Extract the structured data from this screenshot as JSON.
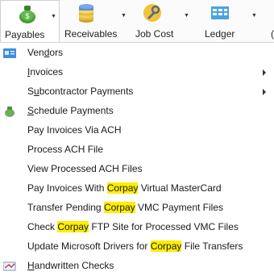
{
  "toolbar": {
    "items": [
      {
        "label": "Payables",
        "icon": "payables-icon",
        "active": true
      },
      {
        "label": "Receivables",
        "icon": "receivables-icon"
      },
      {
        "label": "Job Cost",
        "icon": "job-cost-icon"
      },
      {
        "label": "Ledger",
        "icon": "ledger-icon"
      }
    ]
  },
  "menu": {
    "items": [
      {
        "parts": [
          "Ven",
          "d",
          "ors"
        ],
        "icon": "vendors-icon"
      },
      {
        "parts": [
          "",
          "I",
          "nvoices"
        ],
        "submenu": true
      },
      {
        "parts": [
          "S",
          "u",
          "bcontractor Payments"
        ],
        "submenu": true
      },
      {
        "parts": [
          "",
          "S",
          "chedule Payments"
        ],
        "icon": "schedule-payments-icon"
      },
      {
        "label": "Pay Invoices Via ACH"
      },
      {
        "label": "Process ACH File"
      },
      {
        "label": "View Processed ACH Files"
      },
      {
        "parts": [
          "Pay Invoices With ",
          "Corpay",
          " Virtual MasterCard"
        ]
      },
      {
        "parts": [
          "Transfer Pending ",
          "Corpay",
          " VMC Payment Files"
        ]
      },
      {
        "parts": [
          "Check ",
          "Corpay",
          " FTP Site for Processed VMC Files"
        ]
      },
      {
        "parts": [
          "Update Microsoft Drivers for ",
          "Corpay",
          " File Transfers"
        ]
      },
      {
        "parts": [
          "",
          "H",
          "andwritten Checks"
        ],
        "icon": "handwritten-checks-icon"
      }
    ]
  },
  "colors": {
    "highlight": "#ffee00",
    "toolbar_bg": "#fbfbfb"
  }
}
